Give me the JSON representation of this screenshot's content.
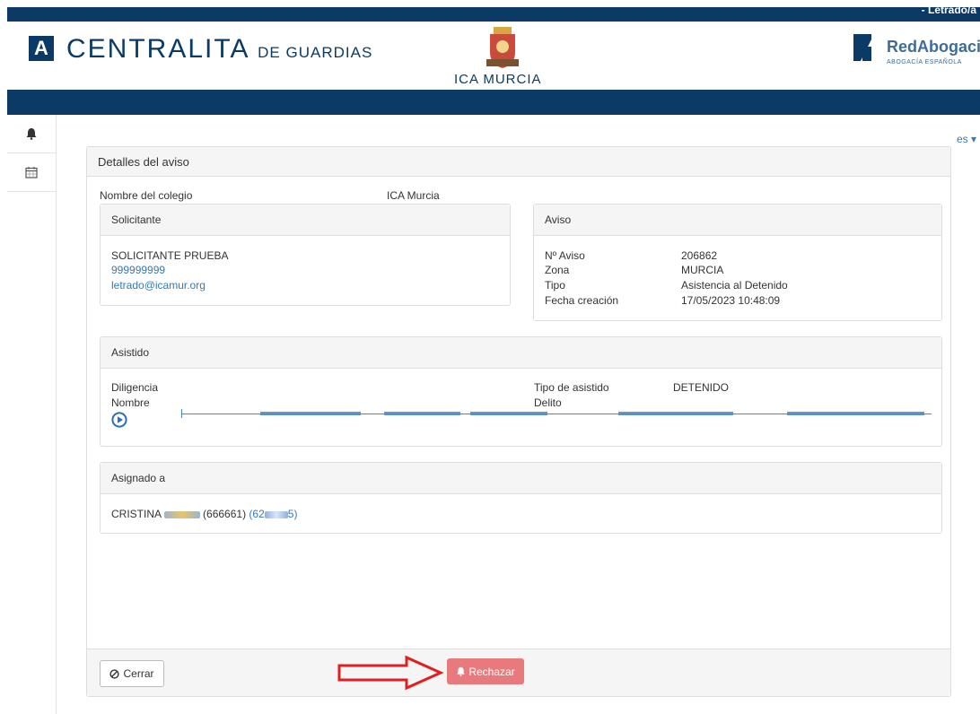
{
  "header": {
    "user_label": "- Letrado/a",
    "app_logo_letter": "A",
    "brand_main": "CENTRALITA",
    "brand_sub": "DE GUARDIAS",
    "bar_label": "ICA MURCIA",
    "partner_name": "RedAbogacia",
    "partner_sub": "ABOGACÍA ESPAÑOLA"
  },
  "sidebar": {
    "items": [
      {
        "icon": "bell-icon"
      },
      {
        "icon": "calendar-icon"
      }
    ]
  },
  "language": {
    "label": "es"
  },
  "panel": {
    "title": "Detalles del aviso",
    "colegio_label": "Nombre del colegio",
    "colegio_value": "ICA Murcia"
  },
  "solicitante": {
    "heading": "Solicitante",
    "name": "SOLICITANTE PRUEBA",
    "phone": "999999999",
    "email": "letrado@icamur.org"
  },
  "aviso": {
    "heading": "Aviso",
    "rows": [
      {
        "label": "Nº Aviso",
        "value": "206862"
      },
      {
        "label": "Zona",
        "value": "MURCIA"
      },
      {
        "label": "Tipo",
        "value": "Asistencia al Detenido"
      },
      {
        "label": "Fecha creación",
        "value": "17/05/2023 10:48:09"
      }
    ]
  },
  "asistido": {
    "heading": "Asistido",
    "diligencia_label": "Diligencia",
    "nombre_label": "Nombre",
    "tipo_label": "Tipo de asistido",
    "tipo_value": "DETENIDO",
    "delito_label": "Delito"
  },
  "asignado": {
    "heading": "Asignado a",
    "name": "CRISTINA",
    "code": "(666661)",
    "phone_prefix": "(62",
    "phone_suffix": "5)"
  },
  "actions": {
    "close_label": "Cerrar",
    "reject_label": "Rechazar"
  },
  "colors": {
    "navy": "#0b3a66",
    "link": "#337ab7",
    "reject": "#e8797d",
    "arrow": "#e02020"
  }
}
